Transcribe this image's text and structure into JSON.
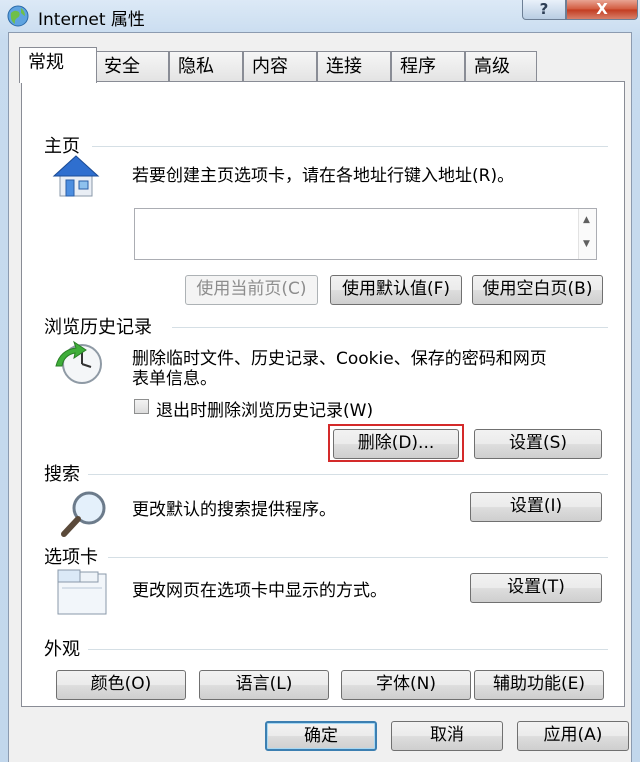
{
  "window": {
    "title": "Internet 属性",
    "help_label": "?",
    "close_label": "X"
  },
  "tabs": [
    {
      "label": "常规",
      "active": true
    },
    {
      "label": "安全"
    },
    {
      "label": "隐私"
    },
    {
      "label": "内容"
    },
    {
      "label": "连接"
    },
    {
      "label": "程序"
    },
    {
      "label": "高级"
    }
  ],
  "homepage": {
    "group_label": "主页",
    "description": "若要创建主页选项卡，请在各地址行键入地址(R)。",
    "address_value": "",
    "use_current": "使用当前页(C)",
    "use_default": "使用默认值(F)",
    "use_blank": "使用空白页(B)"
  },
  "history": {
    "group_label": "浏览历史记录",
    "description_line1": "删除临时文件、历史记录、Cookie、保存的密码和网页",
    "description_line2": "表单信息。",
    "checkbox_label": "退出时删除浏览历史记录(W)",
    "checkbox_checked": false,
    "delete_button": "删除(D)...",
    "settings_button": "设置(S)",
    "highlight_color": "#d42a2a"
  },
  "search": {
    "group_label": "搜索",
    "description": "更改默认的搜索提供程序。",
    "settings_button": "设置(I)"
  },
  "tabs_section": {
    "group_label": "选项卡",
    "description": "更改网页在选项卡中显示的方式。",
    "settings_button": "设置(T)"
  },
  "appearance": {
    "group_label": "外观",
    "colors_button": "颜色(O)",
    "languages_button": "语言(L)",
    "fonts_button": "字体(N)",
    "accessibility_button": "辅助功能(E)"
  },
  "footer": {
    "ok_button": "确定",
    "cancel_button": "取消",
    "apply_button": "应用(A)"
  }
}
